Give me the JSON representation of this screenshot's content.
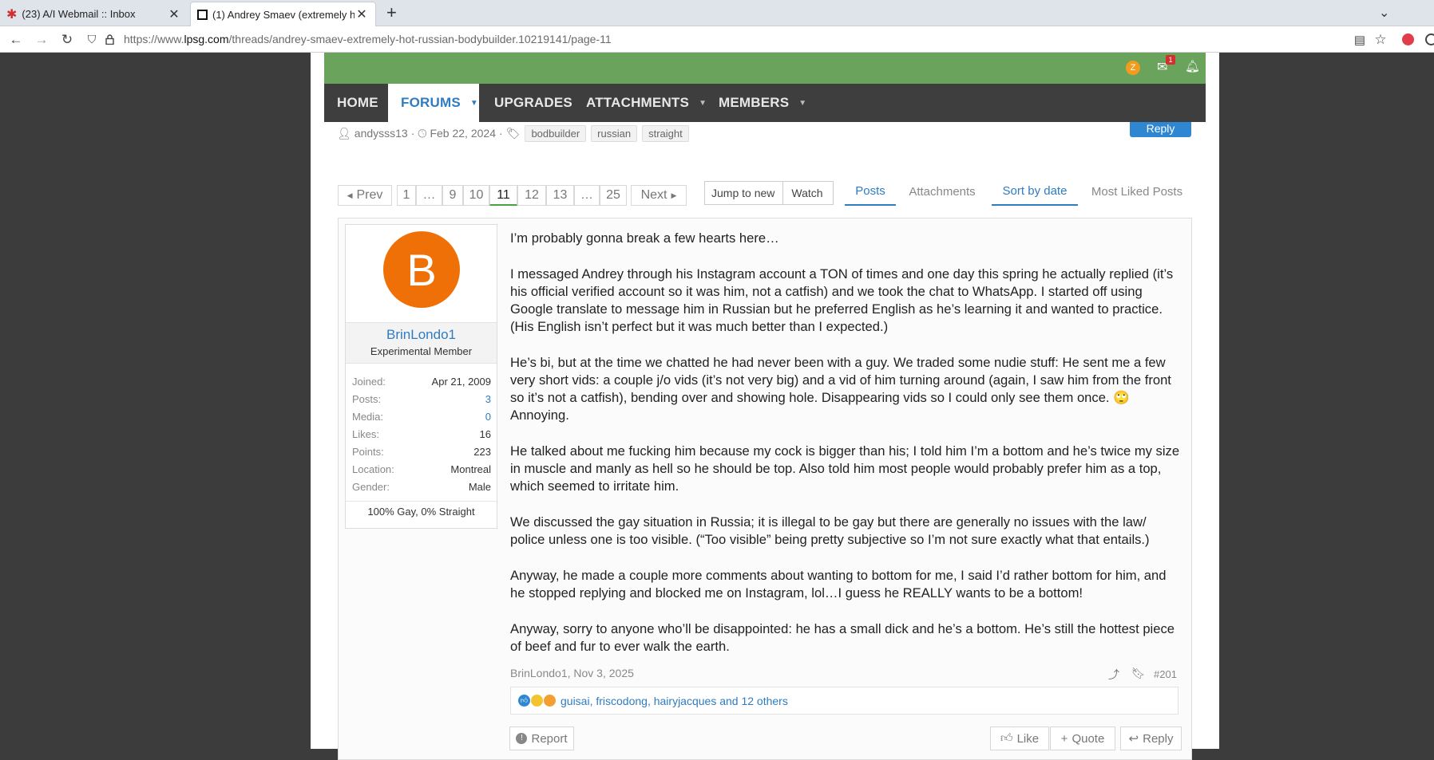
{
  "browser": {
    "tabs": [
      {
        "title": "(23) A/I Webmail :: Inbox"
      },
      {
        "title": "(1) Andrey Smaev (extremely hot r"
      }
    ],
    "url_prefix": "https://www.",
    "url_domain": "lpsg.com",
    "url_path": "/threads/andrey-smaev-extremely-hot-russian-bodybuilder.10219141/page-11"
  },
  "header": {
    "avatar_letter": "Z",
    "inbox_badge": "1"
  },
  "nav": {
    "home": "HOME",
    "forums": "FORUMS",
    "upgrades": "UPGRADES",
    "attachments": "ATTACHMENTS",
    "members": "MEMBERS"
  },
  "thread": {
    "author": "andysss13",
    "date": "Feb 22, 2024",
    "tags": [
      "bodbuilder",
      "russian",
      "straight"
    ],
    "reply_label": "Reply"
  },
  "pagination": {
    "prev": "Prev",
    "pages": [
      "1",
      "…",
      "9",
      "10",
      "11",
      "12",
      "13",
      "…",
      "25"
    ],
    "next": "Next",
    "jump": "Jump to new",
    "watch": "Watch"
  },
  "tabs": [
    "Posts",
    "Attachments",
    "Sort by date",
    "Most Liked Posts"
  ],
  "post": {
    "avatar_letter": "B",
    "username": "BrinLondo1",
    "user_title": "Experimental Member",
    "stats": [
      {
        "k": "Joined:",
        "v": "Apr 21, 2009"
      },
      {
        "k": "Posts:",
        "v": "3"
      },
      {
        "k": "Media:",
        "v": "0"
      },
      {
        "k": "Likes:",
        "v": "16"
      },
      {
        "k": "Points:",
        "v": "223"
      },
      {
        "k": "Location:",
        "v": "Montreal"
      },
      {
        "k": "Gender:",
        "v": "Male"
      }
    ],
    "tagline": "100% Gay, 0% Straight",
    "paragraphs": [
      "I’m probably gonna break a few hearts here…",
      "I messaged Andrey through his Instagram account a TON of times and one day this spring he actually replied (it’s his official verified account so it was him, not a catfish) and we took the chat to WhatsApp. I started off using Google translate to message him in Russian but he preferred English as he’s learning it and wanted to practice. (His English isn’t perfect but it was much better than I expected.)",
      "He’s bi, but at the time we chatted he had never been with a guy. We traded some nudie stuff: He sent me a few very short vids: a couple j/o vids (it’s not very big) and a vid of him turning around (again, I saw him from the front so it’s not a catfish), bending over and showing hole. Disappearing vids so I could only see them once. 🙄 Annoying.",
      "He talked about me fucking him because my cock is bigger than his; I told him I’m a bottom and he’s twice my size in muscle and manly as hell so he should be top. Also told him most people would probably prefer him as a top, which seemed to irritate him.",
      "We discussed the gay situation in Russia; it is illegal to be gay but there are generally no issues with the law/ police unless one is too visible. (“Too visible” being pretty subjective so I’m not sure exactly what that entails.)",
      "Anyway, he made a couple more comments about wanting to bottom for me, I said I’d rather bottom for him, and he stopped replying and blocked me on Instagram, lol…I guess he REALLY wants to be a bottom!",
      "Anyway, sorry to anyone who’ll be disappointed: he has a small dick and he’s a bottom. He’s still the hottest piece of beef and fur to ever walk the earth."
    ],
    "footer_author_date": "BrinLondo1, Nov 3, 2025",
    "post_number": "#201",
    "reactions_text": "guisai, friscodong, hairyjacques and 12 others",
    "report": "Report",
    "like": "Like",
    "quote": "Quote",
    "reply": "Reply"
  }
}
